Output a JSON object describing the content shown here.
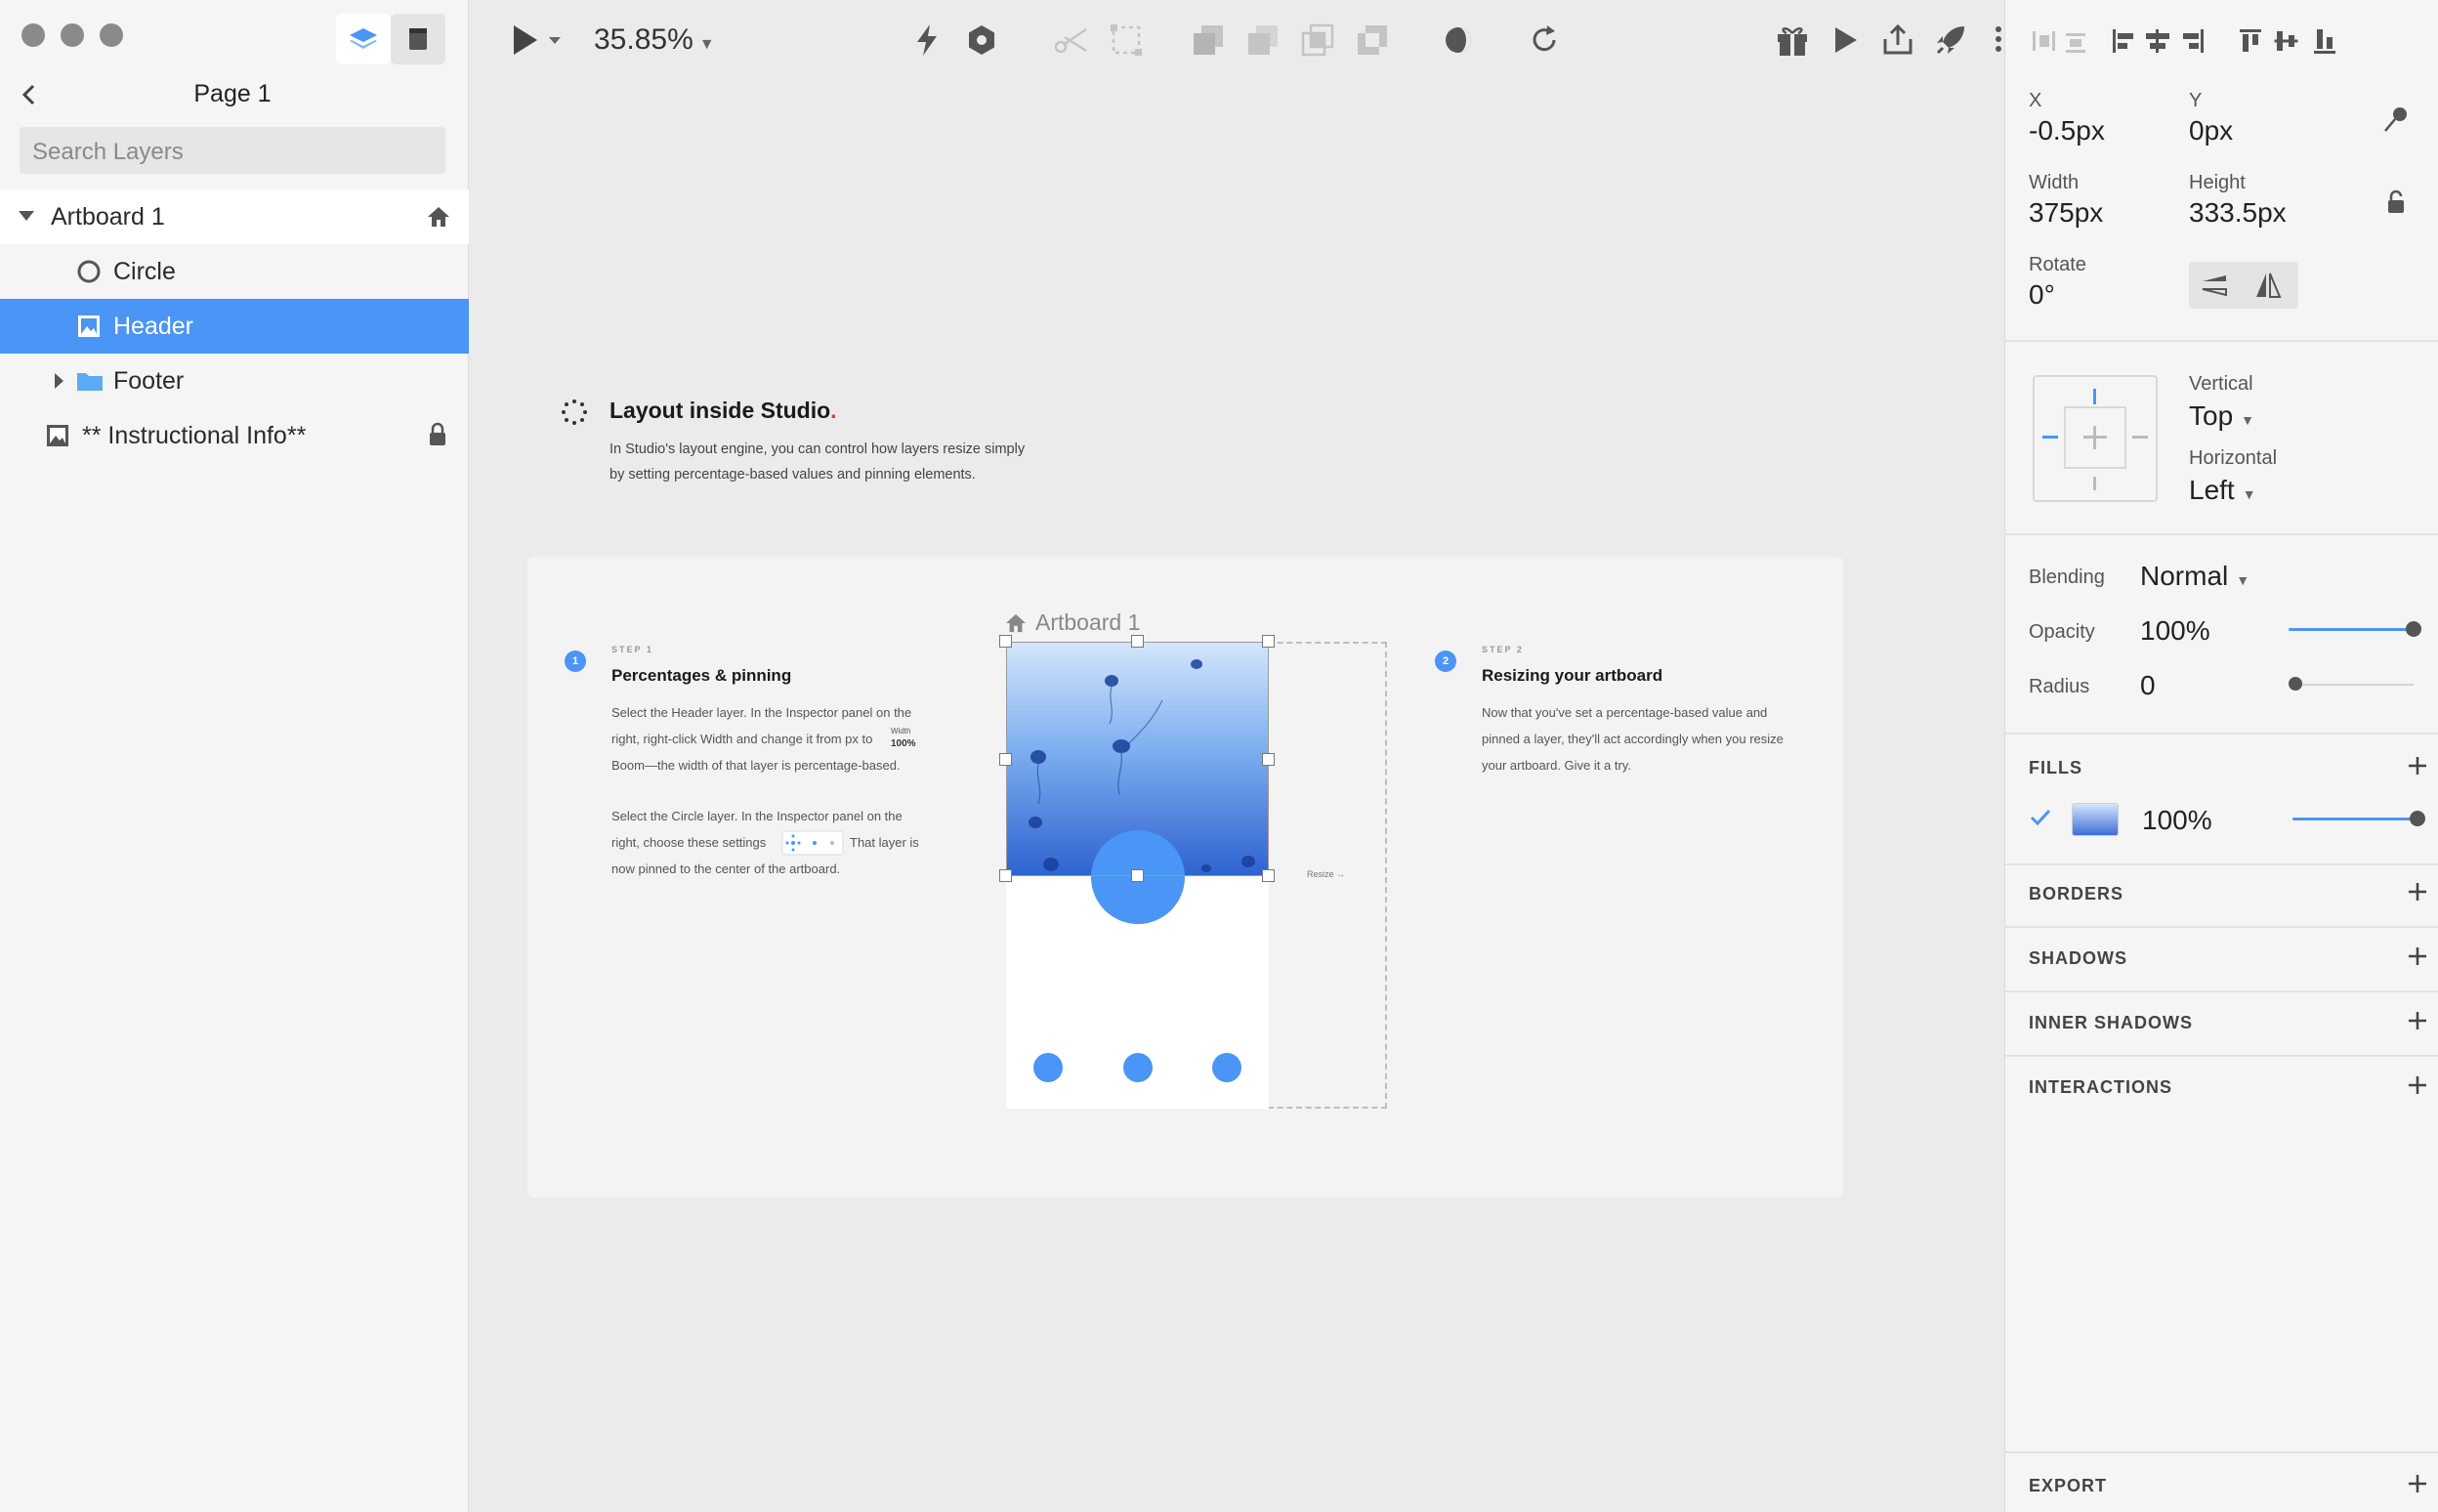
{
  "sidebar": {
    "page_title": "Page 1",
    "search_placeholder": "Search Layers",
    "layers": [
      {
        "label": "Artboard 1"
      },
      {
        "label": "Circle"
      },
      {
        "label": "Header"
      },
      {
        "label": "Footer"
      },
      {
        "label": "** Instructional Info**"
      }
    ]
  },
  "toolbar": {
    "zoom": "35.85%"
  },
  "canvas": {
    "heading": "Layout inside Studio",
    "heading_dot": ".",
    "intro_line1": "In Studio's layout engine, you can control how layers resize simply",
    "intro_line2": "by setting percentage-based values and pinning elements.",
    "artboard_label": "Artboard 1",
    "resize_label": "Resize →",
    "step1": {
      "num": "1",
      "label": "STEP 1",
      "title": "Percentages & pinning",
      "p1_l1": "Select the Header layer. In the Inspector panel on the",
      "p1_l2": "right, right-click Width and change it from px to",
      "width_mini_label": "Width",
      "width_mini_value": "100%",
      "p1_l3": "Boom—the width of that layer is percentage-based.",
      "p2_l1": "Select the Circle layer. In the Inspector panel on the",
      "p2_l2a": "right, choose these settings",
      "p2_l2b": "That layer is",
      "p2_l3": "now pinned to the center of the artboard."
    },
    "step2": {
      "num": "2",
      "label": "STEP 2",
      "title": "Resizing your artboard",
      "l1": "Now that you've set a percentage-based value and",
      "l2": "pinned a layer, they'll act accordingly when you resize",
      "l3": "your artboard. Give it a try."
    }
  },
  "inspector": {
    "x_label": "X",
    "x_value": "-0.5px",
    "y_label": "Y",
    "y_value": "0px",
    "width_label": "Width",
    "width_value": "375px",
    "height_label": "Height",
    "height_value": "333.5px",
    "rotate_label": "Rotate",
    "rotate_value": "0°",
    "vertical_label": "Vertical",
    "vertical_value": "Top",
    "horizontal_label": "Horizontal",
    "horizontal_value": "Left",
    "blending_label": "Blending",
    "blending_value": "Normal",
    "opacity_label": "Opacity",
    "opacity_value": "100%",
    "radius_label": "Radius",
    "radius_value": "0",
    "fills_label": "FILLS",
    "fill_opacity": "100%",
    "borders_label": "BORDERS",
    "shadows_label": "SHADOWS",
    "inner_shadows_label": "INNER SHADOWS",
    "interactions_label": "INTERACTIONS",
    "export_label": "EXPORT"
  },
  "colors": {
    "accent": "#4a95f5",
    "selection": "#4a95f5",
    "heading_dot": "#e8333a"
  },
  "icons": [
    "layers-icon",
    "document-icon",
    "back-chevron-icon",
    "home-icon",
    "circle-icon",
    "image-icon",
    "folder-icon",
    "lock-icon",
    "pointer-icon",
    "bolt-icon",
    "hexagon-icon",
    "scissors-icon",
    "gift-icon",
    "play-icon",
    "share-icon",
    "rocket-icon",
    "plus-icon",
    "check-icon"
  ]
}
